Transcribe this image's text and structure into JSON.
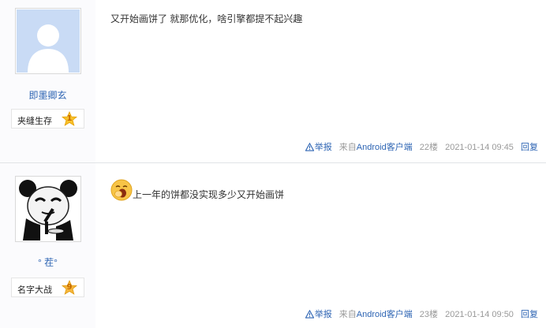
{
  "posts": [
    {
      "username": "即墨卿玄",
      "badge": {
        "name": "夹缝生存",
        "level": "1"
      },
      "content": "又开始画饼了 就那优化，啥引擎都提不起兴趣",
      "tail": {
        "report": "举报",
        "source_prefix": "来自",
        "source_client": "Android客户端",
        "floor": "22楼",
        "time": "2021-01-14 09:45",
        "reply": "回复"
      }
    },
    {
      "username": "° 茬°",
      "badge": {
        "name": "名字大战",
        "level": "9"
      },
      "content": "上一年的饼都没实现多少又开始画饼",
      "tail": {
        "report": "举报",
        "source_prefix": "来自",
        "source_client": "Android客户端",
        "floor": "23楼",
        "time": "2021-01-14 09:50",
        "reply": "回复"
      }
    }
  ],
  "colors": {
    "link": "#2d64b3",
    "meta": "#999999",
    "sidebar": "#fbfbfd",
    "divider": "#e1e4e6"
  }
}
